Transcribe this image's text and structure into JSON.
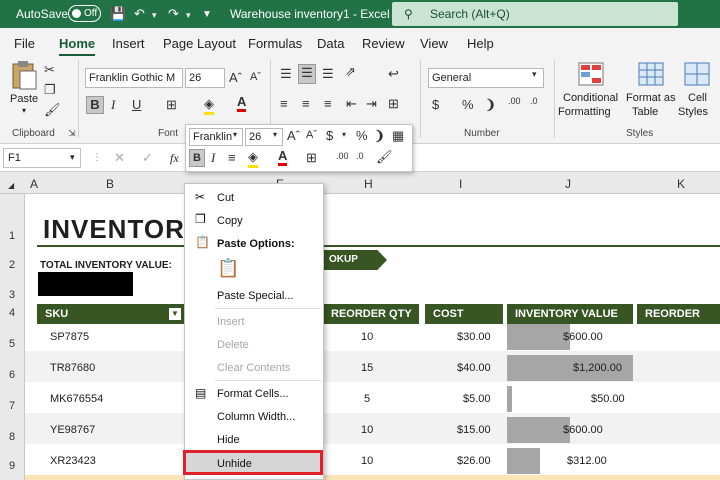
{
  "titlebar": {
    "autosave": "AutoSave",
    "toggle": "Off",
    "title": "Warehouse inventory1  -  Excel",
    "search": "Search (Alt+Q)"
  },
  "tabs": [
    "File",
    "Home",
    "Insert",
    "Page Layout",
    "Formulas",
    "Data",
    "Review",
    "View",
    "Help"
  ],
  "ribbon": {
    "paste": "Paste",
    "clipboard": "Clipboard",
    "font_name": "Franklin Gothic M",
    "font_size": "26",
    "font_group": "Font",
    "number_format": "General",
    "number_group": "Number",
    "cond_fmt_1": "Conditional",
    "cond_fmt_2": "Formatting",
    "fmt_table_1": "Format as",
    "fmt_table_2": "Table",
    "cell_styles_1": "Cell",
    "cell_styles_2": "Styles",
    "styles_group": "Styles"
  },
  "namebox": "F1",
  "columns": [
    "A",
    "B",
    "E",
    "H",
    "I",
    "J",
    "K"
  ],
  "rows": [
    "1",
    "2",
    "3",
    "4",
    "5",
    "6",
    "7",
    "8",
    "9"
  ],
  "sheet": {
    "title": "INVENTORY",
    "total_label": "TOTAL INVENTORY VALUE:",
    "lookup_tag": "OKUP",
    "headers": {
      "sku": "SKU",
      "reorder_qty": "REORDER QTY",
      "cost": "COST",
      "inventory_value": "INVENTORY VALUE",
      "reorder": "REORDER"
    },
    "items": [
      {
        "sku": "SP7875",
        "qty": "10",
        "cost": "$30.00",
        "value": "$600.00",
        "fill": 0.5
      },
      {
        "sku": "TR87680",
        "qty": "15",
        "cost": "$40.00",
        "value": "$1,200.00",
        "fill": 1.0
      },
      {
        "sku": "MK676554",
        "qty": "5",
        "cost": "$5.00",
        "value": "$50.00",
        "fill": 0.04
      },
      {
        "sku": "YE98767",
        "qty": "10",
        "cost": "$15.00",
        "value": "$600.00",
        "fill": 0.5
      },
      {
        "sku": "XR23423",
        "qty": "10",
        "cost": "$26.00",
        "value": "$312.00",
        "fill": 0.26
      }
    ]
  },
  "minibar": {
    "font": "Franklin",
    "size": "26"
  },
  "context_menu": {
    "cut": "Cut",
    "copy": "Copy",
    "paste_options": "Paste Options:",
    "paste_special": "Paste Special...",
    "insert": "Insert",
    "delete": "Delete",
    "clear_contents": "Clear Contents",
    "format_cells": "Format Cells...",
    "column_width": "Column Width...",
    "hide": "Hide",
    "unhide": "Unhide"
  },
  "colors": {
    "excel_green": "#217346",
    "table_header": "#375623",
    "highlight_box": "#e0202a",
    "hover": "#d6d6d6"
  }
}
